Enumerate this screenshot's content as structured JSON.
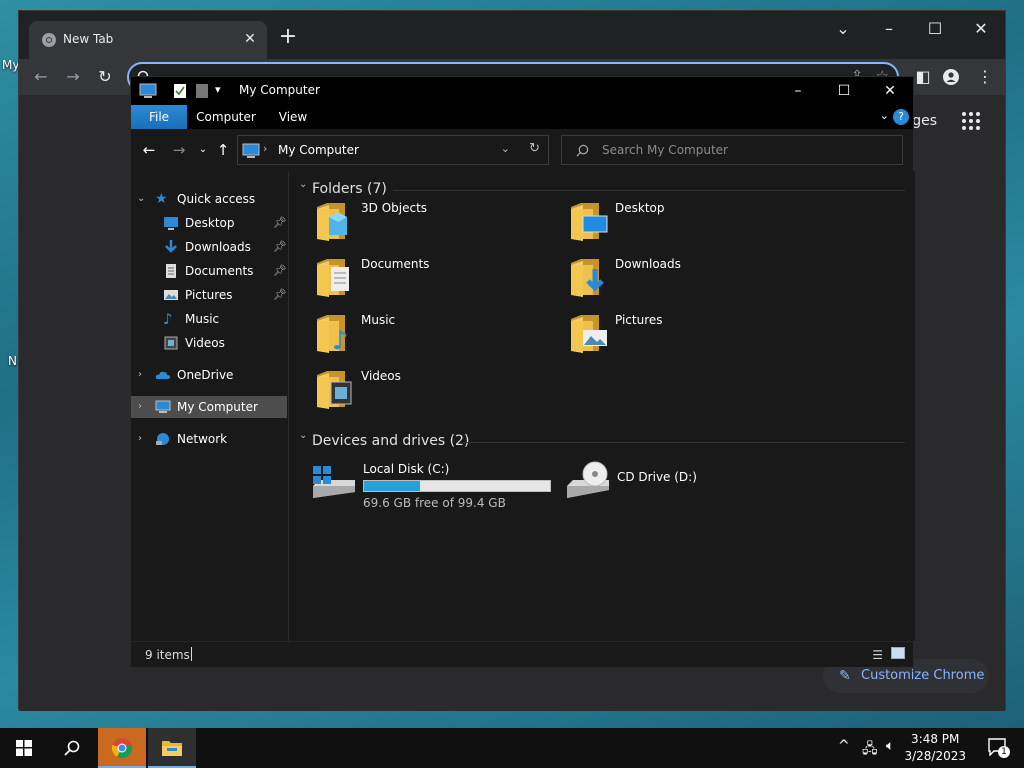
{
  "desktop": {
    "fragments": [
      "My",
      "N"
    ]
  },
  "chrome": {
    "tab_title": "New Tab",
    "new_tab_symbol": "+",
    "images_link": "ges",
    "customize_label": "Customize Chrome"
  },
  "explorer": {
    "window_title": "My Computer",
    "ribbon_tabs": [
      "File",
      "Computer",
      "View"
    ],
    "address_path": "My Computer",
    "search_placeholder": "Search My Computer",
    "nav": {
      "quick_access": "Quick access",
      "quick_items": [
        "Desktop",
        "Downloads",
        "Documents",
        "Pictures",
        "Music",
        "Videos"
      ],
      "onedrive": "OneDrive",
      "my_computer": "My Computer",
      "network": "Network"
    },
    "folders_header": "Folders (7)",
    "folders": [
      "3D Objects",
      "Desktop",
      "Documents",
      "Downloads",
      "Music",
      "Pictures",
      "Videos"
    ],
    "devices_header": "Devices and drives (2)",
    "drives": [
      {
        "name": "Local Disk (C:)",
        "free_text": "69.6 GB free of 99.4 GB",
        "used_fraction": 0.3
      },
      {
        "name": "CD Drive (D:)"
      }
    ],
    "status_count": "9 items",
    "accent": "#1979ca"
  },
  "taskbar": {
    "time": "3:48 PM",
    "date": "3/28/2023",
    "notification_count": "1"
  }
}
